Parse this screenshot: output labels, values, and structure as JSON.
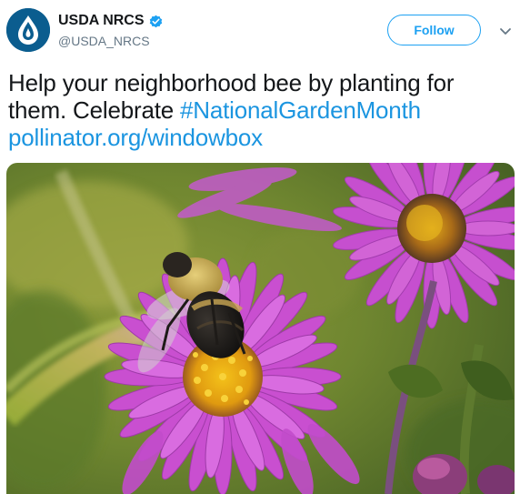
{
  "account": {
    "display_name": "USDA NRCS",
    "handle": "@USDA_NRCS",
    "verified_icon": "verified-badge-icon",
    "avatar_icon": "water-drop-icon",
    "avatar_color": "#005a8c"
  },
  "actions": {
    "follow_label": "Follow",
    "more_icon": "chevron-down-icon"
  },
  "tweet": {
    "text_line_1": "Help your neighborhood bee by planting for them. Celebrate ",
    "hashtag": "#NationalGardenMonth",
    "link": "pollinator.org/windowbox"
  },
  "colors": {
    "link_blue": "#1b95e0",
    "follow_blue": "#1da1f2",
    "flower_purple": "#c94fd0"
  }
}
